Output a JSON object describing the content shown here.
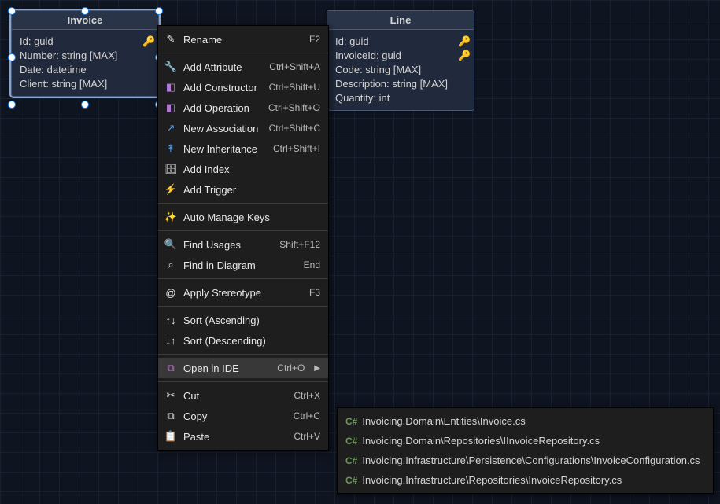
{
  "entities": {
    "invoice": {
      "title": "Invoice",
      "attrs": {
        "id": "Id: guid",
        "number": "Number: string [MAX]",
        "date": "Date: datetime",
        "client": "Client: string [MAX]"
      }
    },
    "line": {
      "title": "Line",
      "attrs": {
        "id": "Id: guid",
        "invoiceId": "InvoiceId: guid",
        "code": "Code: string [MAX]",
        "description": "Description: string [MAX]",
        "quantity": "Quantity: int"
      }
    }
  },
  "menu": {
    "rename": {
      "label": "Rename",
      "shortcut": "F2"
    },
    "addAttribute": {
      "label": "Add Attribute",
      "shortcut": "Ctrl+Shift+A"
    },
    "addConstructor": {
      "label": "Add Constructor",
      "shortcut": "Ctrl+Shift+U"
    },
    "addOperation": {
      "label": "Add Operation",
      "shortcut": "Ctrl+Shift+O"
    },
    "newAssociation": {
      "label": "New Association",
      "shortcut": "Ctrl+Shift+C"
    },
    "newInheritance": {
      "label": "New Inheritance",
      "shortcut": "Ctrl+Shift+I"
    },
    "addIndex": {
      "label": "Add Index",
      "shortcut": ""
    },
    "addTrigger": {
      "label": "Add Trigger",
      "shortcut": ""
    },
    "autoManageKeys": {
      "label": "Auto Manage Keys",
      "shortcut": ""
    },
    "findUsages": {
      "label": "Find Usages",
      "shortcut": "Shift+F12"
    },
    "findInDiagram": {
      "label": "Find in Diagram",
      "shortcut": "End"
    },
    "applyStereotype": {
      "label": "Apply Stereotype",
      "shortcut": "F3"
    },
    "sortAsc": {
      "label": "Sort (Ascending)",
      "shortcut": ""
    },
    "sortDesc": {
      "label": "Sort (Descending)",
      "shortcut": ""
    },
    "openInIDE": {
      "label": "Open in IDE",
      "shortcut": "Ctrl+O"
    },
    "cut": {
      "label": "Cut",
      "shortcut": "Ctrl+X"
    },
    "copy": {
      "label": "Copy",
      "shortcut": "Ctrl+C"
    },
    "paste": {
      "label": "Paste",
      "shortcut": "Ctrl+V"
    }
  },
  "submenu": {
    "csTag": "C#",
    "items": [
      "Invoicing.Domain\\Entities\\Invoice.cs",
      "Invoicing.Domain\\Repositories\\IInvoiceRepository.cs",
      "Invoicing.Infrastructure\\Persistence\\Configurations\\InvoiceConfiguration.cs",
      "Invoicing.Infrastructure\\Repositories\\InvoiceRepository.cs"
    ]
  }
}
